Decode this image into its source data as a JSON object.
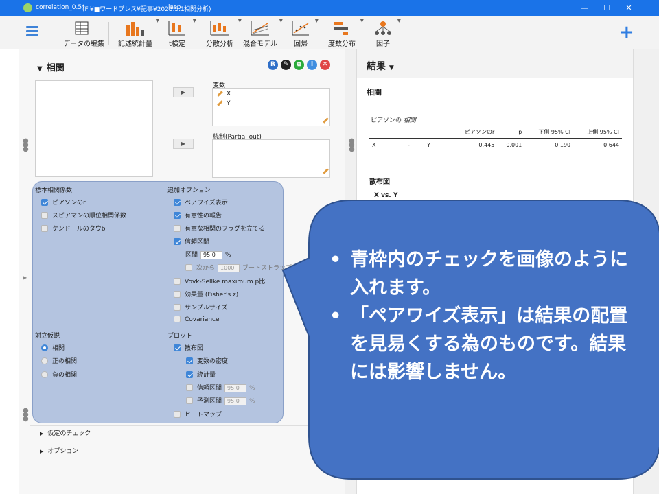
{
  "window": {
    "file": "correlation_0.5*",
    "path": "(F:¥■ワードプレス¥記事¥2025.5.1",
    "app": "jasp",
    "subtitle": "相関分析)",
    "min": "—",
    "max": "☐",
    "close": "✕"
  },
  "toolbar": {
    "items": [
      {
        "label": "データの編集"
      },
      {
        "label": "記述統計量"
      },
      {
        "label": "t検定"
      },
      {
        "label": "分散分析"
      },
      {
        "label": "混合モデル"
      },
      {
        "label": "回帰"
      },
      {
        "label": "度数分布"
      },
      {
        "label": "因子"
      }
    ],
    "add": "+"
  },
  "analysis": {
    "title": "相関",
    "collapse_glyph": "▼",
    "icons": [
      {
        "text": "R",
        "color": "#2f6fc8"
      },
      {
        "text": "✎",
        "color": "#222222"
      },
      {
        "text": "⧉",
        "color": "#2bab3c"
      },
      {
        "text": "i",
        "color": "#3f8ee0"
      },
      {
        "text": "✕",
        "color": "#e04545"
      }
    ],
    "arrow": "▶",
    "variables_label": "変数",
    "variables": [
      "X",
      "Y"
    ],
    "partial_label": "統制(Partial out)"
  },
  "options": {
    "sample_title": "標本相関係数",
    "sample": [
      {
        "label": "ピアソンのr",
        "checked": true
      },
      {
        "label": "スピアマンの順位相関係数",
        "checked": false
      },
      {
        "label": "ケンドールのタウb",
        "checked": false
      }
    ],
    "extra_title": "追加オプション",
    "extra": [
      {
        "label": "ペアワイズ表示",
        "checked": true
      },
      {
        "label": "有意性の報告",
        "checked": true
      },
      {
        "label": "有意な相関のフラグを立てる",
        "checked": false
      },
      {
        "label": "信頼区間",
        "checked": true
      }
    ],
    "ci_label": "区間",
    "ci_value": "95.0",
    "ci_unit": "%",
    "boot_label": "次から",
    "boot_value": "1000",
    "boot_unit": "ブートストラップ",
    "extra2": [
      {
        "label": "Vovk-Sellke maximum p比",
        "checked": false
      },
      {
        "label": "効果量 (Fisher's z)",
        "checked": false
      },
      {
        "label": "サンプルサイズ",
        "checked": false
      },
      {
        "label": "Covariance",
        "checked": false
      }
    ],
    "hyp_title": "対立仮説",
    "hyp": [
      {
        "label": "相関",
        "checked": true
      },
      {
        "label": "正の相関",
        "checked": false
      },
      {
        "label": "負の相関",
        "checked": false
      }
    ],
    "plot_title": "プロット",
    "plot_scatter": "散布図",
    "plot_density": "変数の密度",
    "plot_stats": "統計量",
    "plot_ci": "信頼区間",
    "plot_ci_value": "95.0",
    "plot_pi": "予測区間",
    "plot_pi_value": "95.0",
    "plot_unit": "%",
    "plot_heatmap": "ヒートマップ"
  },
  "sections": {
    "assumptions": "仮定のチェック",
    "options": "オプション",
    "glyph": "▶"
  },
  "results": {
    "header": "結果",
    "header_caret": "▼",
    "section": "相関",
    "table_caption": "ピアソンの",
    "table_caption_em": "相関",
    "columns": [
      "",
      "",
      "",
      "ピアソンのr",
      "p",
      "下側 95% CI",
      "上側 95% CI"
    ],
    "row": [
      "X",
      "-",
      "Y",
      "0.445",
      "0.001",
      "0.190",
      "0.644"
    ],
    "scatter_title": "散布図",
    "scatter_sub": "X vs. Y"
  },
  "callout": {
    "bullets": [
      "青枠内のチェックを画像のように入れます。",
      "「ペアワイズ表示」は結果の配置を見易くする為のものです。結果には影響しません。"
    ],
    "color": "#4472c4"
  }
}
